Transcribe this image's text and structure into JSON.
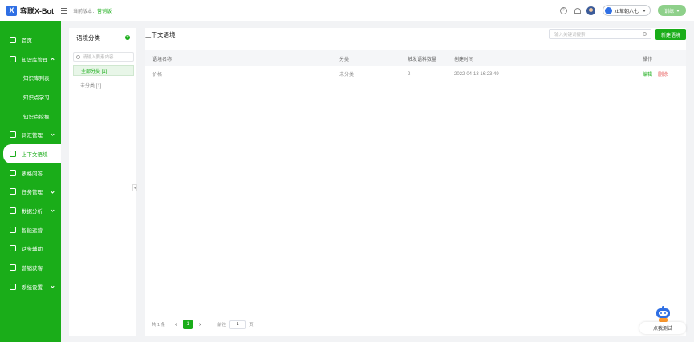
{
  "app": {
    "name": "容联X-Bot"
  },
  "header": {
    "version_label": "当前版本：",
    "version_value": "营销版",
    "bot_name": "xb革朝六七",
    "train_label": "训练"
  },
  "sidebar": {
    "items": [
      {
        "label": "首页"
      },
      {
        "label": "知识库管理"
      },
      {
        "label": "知识库列表"
      },
      {
        "label": "知识点学习"
      },
      {
        "label": "知识点挖掘"
      },
      {
        "label": "词汇管理"
      },
      {
        "label": "上下文语境"
      },
      {
        "label": "表格问答"
      },
      {
        "label": "任务管理"
      },
      {
        "label": "数据分析"
      },
      {
        "label": "智能运营"
      },
      {
        "label": "话务辅助"
      },
      {
        "label": "营销获客"
      },
      {
        "label": "系统设置"
      }
    ]
  },
  "categories": {
    "title": "语境分类",
    "search_placeholder": "请输入要素内容",
    "items": [
      {
        "label": "全部分类 [1]"
      },
      {
        "label": "未分类 [1]"
      }
    ]
  },
  "main": {
    "title": "上下文语境",
    "search_placeholder": "输入关键词搜索",
    "new_button": "新建语境",
    "columns": [
      "语境名称",
      "分类",
      "触发语料数量",
      "创建时间",
      "操作"
    ],
    "rows": [
      {
        "name": "价格",
        "category": "未分类",
        "count": "2",
        "created": "2022-04-13 16:23:49",
        "edit": "编辑",
        "delete": "删除"
      }
    ],
    "pager": {
      "total": "共 1 条",
      "current": "1",
      "goto_prefix": "前往",
      "goto_value": "1",
      "goto_suffix": "页"
    }
  },
  "assistant": {
    "label": "点我测试"
  },
  "colors": {
    "primary": "#1aad19",
    "danger": "#e54c4c",
    "brand_blue": "#2f6fe4"
  }
}
